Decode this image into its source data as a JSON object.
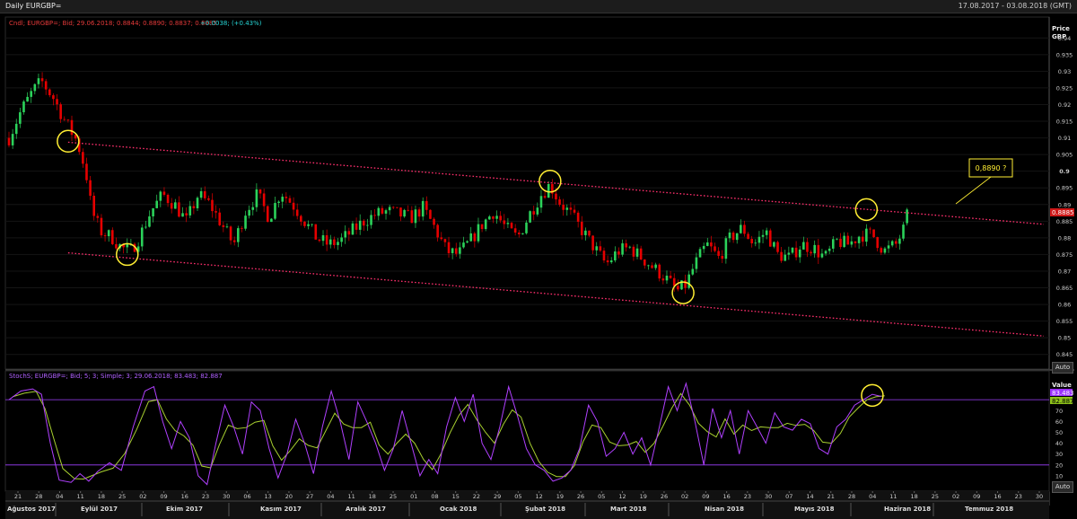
{
  "window": {
    "title": "Daily EURGBP=",
    "date_range": "17.08.2017 - 03.08.2018 (GMT)"
  },
  "price_panel": {
    "legend_name": "Cndl; EURGBP=; Bid; 29.06.2018; 0.8844; 0.8890; 0.8837; 0.8885",
    "legend_change": "+0.0038; (+0.43%)",
    "axis_title": "Price",
    "axis_unit": "GBP",
    "yticks": [
      "0.94",
      "0.935",
      "0.93",
      "0.925",
      "0.92",
      "0.915",
      "0.91",
      "0.905",
      "0.9",
      "0.895",
      "0.89",
      "0.885",
      "0.88",
      "0.875",
      "0.87",
      "0.865",
      "0.86",
      "0.855",
      "0.85",
      "0.845"
    ],
    "last_price_label": "0.8885",
    "annotation": "0,8890 ?",
    "auto_label": "Auto",
    "colors": {
      "up": "#2bd25a",
      "down": "#e60000",
      "channel": "#ff2f6d",
      "highlight": "#ffee33"
    }
  },
  "stoch_panel": {
    "legend": "StochS; EURGBP=; Bid; 5; 3; Simple; 3; 29.06.2018; 83.483; 82.887",
    "axis_title": "Value",
    "yticks": [
      "70",
      "60",
      "50",
      "40",
      "30",
      "20",
      "10"
    ],
    "k_label": "83.483",
    "d_label": "82.887",
    "auto_label": "Auto",
    "levels": [
      80,
      20
    ],
    "colors": {
      "k": "#b040ff",
      "d": "#a8d030"
    }
  },
  "x_axis": {
    "day_ticks": [
      "21",
      "28",
      "04",
      "11",
      "18",
      "25",
      "02",
      "09",
      "16",
      "23",
      "30",
      "06",
      "13",
      "20",
      "27",
      "04",
      "11",
      "18",
      "25",
      "01",
      "08",
      "15",
      "22",
      "29",
      "05",
      "12",
      "19",
      "26",
      "05",
      "12",
      "19",
      "26",
      "02",
      "09",
      "16",
      "23",
      "30",
      "07",
      "14",
      "21",
      "28",
      "04",
      "11",
      "18",
      "25",
      "02",
      "09",
      "16",
      "23",
      "30"
    ],
    "months": [
      "Ağustos 2017",
      "Eylül 2017",
      "Ekim 2017",
      "Kasım 2017",
      "Aralık 2017",
      "Ocak 2018",
      "Şubat 2018",
      "Mart 2018",
      "Nisan 2018",
      "Mayıs 2018",
      "Haziran 2018",
      "Temmuz 2018"
    ]
  },
  "chart_data": {
    "type": "candlestick",
    "symbol": "EURGBP=",
    "ylim": [
      0.8425,
      0.9425
    ],
    "last": {
      "date": "29.06.2018",
      "open": 0.8844,
      "high": 0.889,
      "low": 0.8837,
      "close": 0.8885
    },
    "price_path": [
      [
        0,
        0.91
      ],
      [
        4,
        0.918
      ],
      [
        8,
        0.924
      ],
      [
        11,
        0.927
      ],
      [
        15,
        0.922
      ],
      [
        19,
        0.915
      ],
      [
        23,
        0.909
      ],
      [
        26,
        0.9
      ],
      [
        28,
        0.888
      ],
      [
        31,
        0.882
      ],
      [
        35,
        0.88
      ],
      [
        38,
        0.877
      ],
      [
        41,
        0.876
      ],
      [
        44,
        0.88
      ],
      [
        48,
        0.888
      ],
      [
        52,
        0.893
      ],
      [
        56,
        0.89
      ],
      [
        60,
        0.885
      ],
      [
        64,
        0.893
      ],
      [
        68,
        0.89
      ],
      [
        72,
        0.884
      ],
      [
        76,
        0.878
      ],
      [
        80,
        0.888
      ],
      [
        84,
        0.893
      ],
      [
        88,
        0.886
      ],
      [
        92,
        0.894
      ],
      [
        96,
        0.89
      ],
      [
        100,
        0.885
      ],
      [
        104,
        0.88
      ],
      [
        108,
        0.878
      ],
      [
        112,
        0.879
      ],
      [
        116,
        0.882
      ],
      [
        120,
        0.885
      ],
      [
        124,
        0.887
      ],
      [
        128,
        0.888
      ],
      [
        132,
        0.887
      ],
      [
        136,
        0.886
      ],
      [
        140,
        0.889
      ],
      [
        144,
        0.883
      ],
      [
        148,
        0.876
      ],
      [
        152,
        0.875
      ],
      [
        156,
        0.879
      ],
      [
        160,
        0.884
      ],
      [
        164,
        0.888
      ],
      [
        168,
        0.883
      ],
      [
        172,
        0.88
      ],
      [
        176,
        0.887
      ],
      [
        180,
        0.893
      ],
      [
        183,
        0.896
      ],
      [
        186,
        0.891
      ],
      [
        190,
        0.887
      ],
      [
        194,
        0.882
      ],
      [
        198,
        0.877
      ],
      [
        202,
        0.872
      ],
      [
        206,
        0.876
      ],
      [
        210,
        0.877
      ],
      [
        214,
        0.874
      ],
      [
        218,
        0.871
      ],
      [
        222,
        0.868
      ],
      [
        226,
        0.864
      ],
      [
        229,
        0.866
      ],
      [
        232,
        0.872
      ],
      [
        236,
        0.878
      ],
      [
        240,
        0.874
      ],
      [
        244,
        0.88
      ],
      [
        248,
        0.883
      ],
      [
        252,
        0.878
      ],
      [
        256,
        0.882
      ],
      [
        260,
        0.875
      ],
      [
        264,
        0.874
      ],
      [
        268,
        0.878
      ],
      [
        272,
        0.877
      ],
      [
        276,
        0.874
      ],
      [
        280,
        0.879
      ],
      [
        284,
        0.878
      ],
      [
        288,
        0.881
      ],
      [
        292,
        0.881
      ],
      [
        296,
        0.876
      ],
      [
        300,
        0.878
      ],
      [
        304,
        0.885
      ]
    ],
    "stochastic": {
      "params": "5; 3; Simple; 3",
      "k_last": 83.483,
      "d_last": 82.887,
      "k_path": [
        [
          0,
          80
        ],
        [
          4,
          88
        ],
        [
          8,
          90
        ],
        [
          11,
          85
        ],
        [
          14,
          40
        ],
        [
          17,
          6
        ],
        [
          21,
          4
        ],
        [
          24,
          12
        ],
        [
          27,
          5
        ],
        [
          30,
          14
        ],
        [
          34,
          22
        ],
        [
          38,
          15
        ],
        [
          42,
          55
        ],
        [
          46,
          88
        ],
        [
          49,
          92
        ],
        [
          52,
          60
        ],
        [
          55,
          35
        ],
        [
          58,
          60
        ],
        [
          61,
          45
        ],
        [
          64,
          10
        ],
        [
          67,
          2
        ],
        [
          70,
          40
        ],
        [
          73,
          75
        ],
        [
          76,
          55
        ],
        [
          79,
          30
        ],
        [
          82,
          78
        ],
        [
          85,
          70
        ],
        [
          88,
          35
        ],
        [
          91,
          8
        ],
        [
          94,
          30
        ],
        [
          97,
          62
        ],
        [
          100,
          40
        ],
        [
          103,
          12
        ],
        [
          106,
          55
        ],
        [
          109,
          88
        ],
        [
          112,
          60
        ],
        [
          115,
          25
        ],
        [
          118,
          78
        ],
        [
          121,
          60
        ],
        [
          124,
          40
        ],
        [
          127,
          15
        ],
        [
          130,
          35
        ],
        [
          133,
          70
        ],
        [
          136,
          40
        ],
        [
          139,
          10
        ],
        [
          142,
          25
        ],
        [
          145,
          12
        ],
        [
          148,
          55
        ],
        [
          151,
          82
        ],
        [
          154,
          60
        ],
        [
          157,
          85
        ],
        [
          160,
          40
        ],
        [
          163,
          25
        ],
        [
          166,
          55
        ],
        [
          169,
          92
        ],
        [
          172,
          65
        ],
        [
          175,
          35
        ],
        [
          178,
          20
        ],
        [
          181,
          15
        ],
        [
          184,
          5
        ],
        [
          187,
          8
        ],
        [
          190,
          15
        ],
        [
          193,
          35
        ],
        [
          196,
          75
        ],
        [
          199,
          60
        ],
        [
          202,
          28
        ],
        [
          205,
          35
        ],
        [
          208,
          50
        ],
        [
          211,
          30
        ],
        [
          214,
          45
        ],
        [
          217,
          20
        ],
        [
          220,
          55
        ],
        [
          223,
          92
        ],
        [
          226,
          70
        ],
        [
          229,
          95
        ],
        [
          232,
          60
        ],
        [
          235,
          20
        ],
        [
          238,
          72
        ],
        [
          241,
          45
        ],
        [
          244,
          70
        ],
        [
          247,
          30
        ],
        [
          250,
          70
        ],
        [
          253,
          55
        ],
        [
          256,
          40
        ],
        [
          259,
          68
        ],
        [
          262,
          55
        ],
        [
          265,
          52
        ],
        [
          268,
          62
        ],
        [
          271,
          58
        ],
        [
          274,
          35
        ],
        [
          277,
          30
        ],
        [
          280,
          55
        ],
        [
          283,
          62
        ],
        [
          286,
          75
        ],
        [
          289,
          80
        ],
        [
          292,
          85
        ],
        [
          295,
          83
        ]
      ]
    },
    "channel": {
      "upper": [
        [
          20,
          0.9087
        ],
        [
          304,
          0.8875
        ]
      ],
      "lower": [
        [
          20,
          0.8755
        ],
        [
          304,
          0.854
        ]
      ]
    },
    "highlights": [
      {
        "target": "price",
        "t": 20,
        "v": 0.909
      },
      {
        "target": "price",
        "t": 40,
        "v": 0.875
      },
      {
        "target": "price",
        "t": 183,
        "v": 0.897
      },
      {
        "target": "price",
        "t": 228,
        "v": 0.8635
      },
      {
        "target": "price",
        "t": 290,
        "v": 0.8885
      },
      {
        "target": "stoch",
        "t": 292,
        "v": 84
      }
    ]
  }
}
